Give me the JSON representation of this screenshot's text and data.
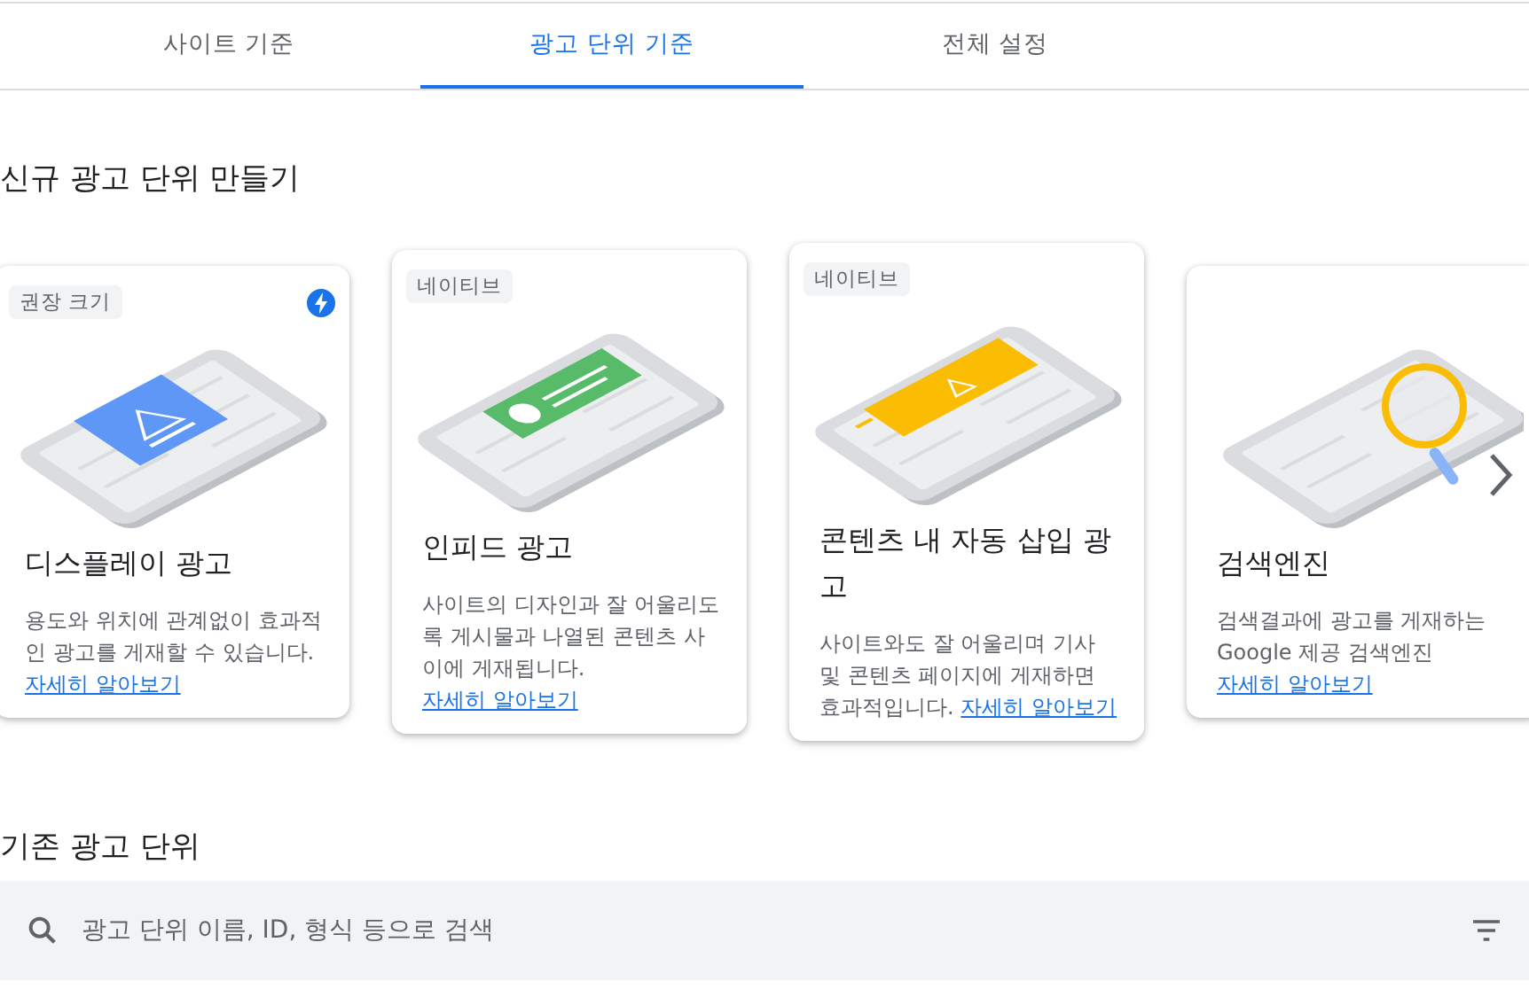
{
  "tabs": [
    {
      "label": "사이트 기준",
      "selected": false
    },
    {
      "label": "광고 단위 기준",
      "selected": true
    },
    {
      "label": "전체 설정",
      "selected": false
    }
  ],
  "new_ad_units": {
    "title": "신규 광고 단위 만들기",
    "cards": [
      {
        "kind": "display",
        "tag": "권장 크기",
        "amp": true,
        "title": "디스플레이 광고",
        "description": "용도와 위치에 관계없이 효과적인 광고를 게재할 수 있습니다.",
        "link": "자세히 알아보기"
      },
      {
        "kind": "infeed",
        "tag": "네이티브",
        "amp": false,
        "title": "인피드 광고",
        "description": "사이트의 디자인과 잘 어울리도록 게시물과 나열된 콘텐츠 사이에 게재됩니다.",
        "link": "자세히 알아보기"
      },
      {
        "kind": "inarticle",
        "tag": "네이티브",
        "amp": false,
        "title": "콘텐츠 내 자동 삽입 광고",
        "description": "사이트와도 잘 어울리며 기사 및 콘텐츠 페이지에 게재하면 효과적입니다.",
        "link": "자세히 알아보기"
      },
      {
        "kind": "search",
        "amp": false,
        "title": "검색엔진",
        "description": "검색결과에 광고를 게재하는 Google 제공 검색엔진",
        "link": "자세히 알아보기"
      }
    ]
  },
  "existing_ad_units": {
    "title": "기존 광고 단위",
    "search": {
      "placeholder": "광고 단위 이름, ID, 형식 등으로 검색"
    }
  }
}
